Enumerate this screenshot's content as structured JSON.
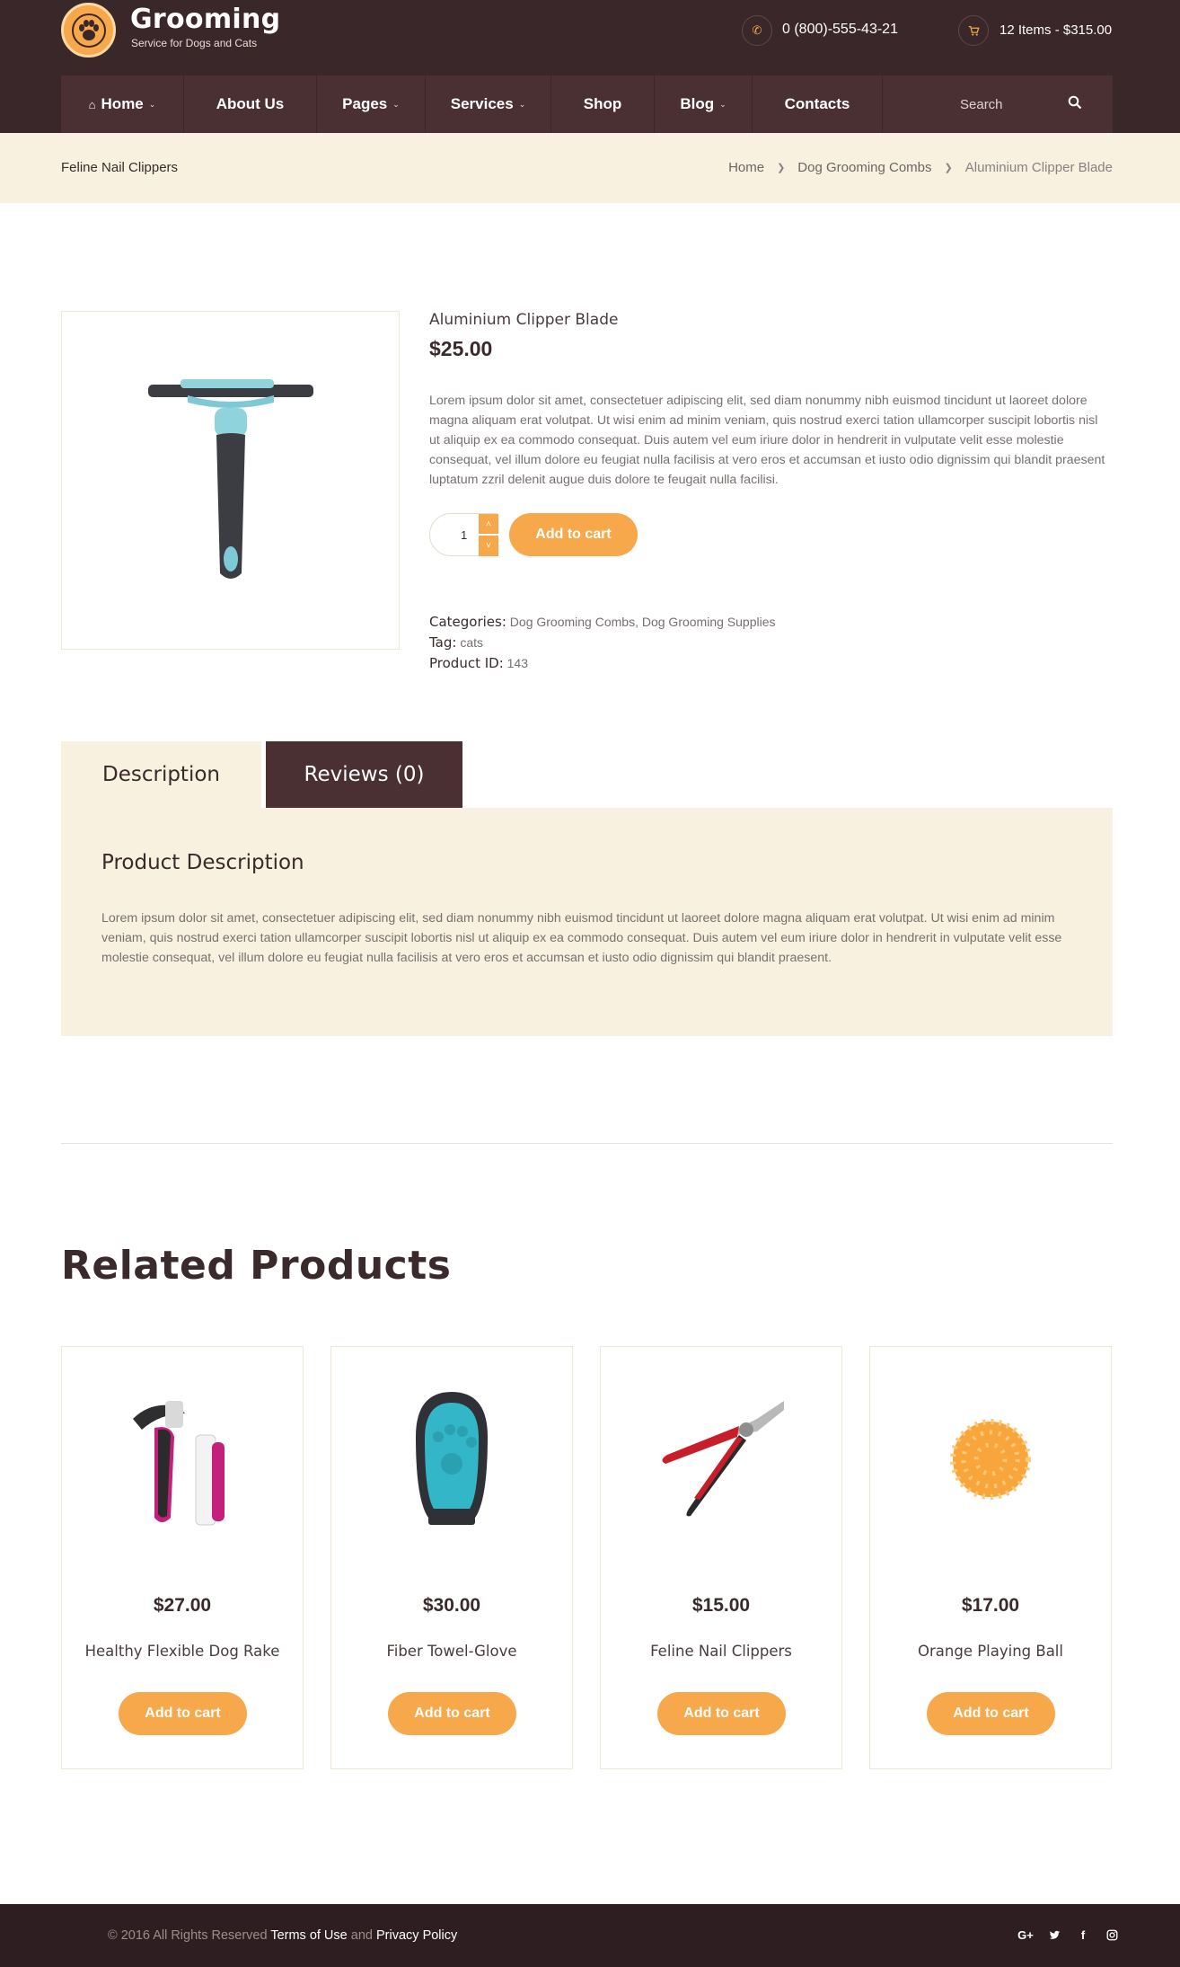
{
  "brand": {
    "title": "Grooming",
    "subtitle": "Service for Dogs and Cats",
    "accent": "#f6a84a",
    "dark": "#3a272a"
  },
  "header": {
    "phone": "0 (800)-555-43-21",
    "cart": "12 Items - $315.00"
  },
  "nav": {
    "items": [
      {
        "label": "Home",
        "has_dropdown": true,
        "icon": "home-icon"
      },
      {
        "label": "About Us",
        "has_dropdown": false
      },
      {
        "label": "Pages",
        "has_dropdown": true
      },
      {
        "label": "Services",
        "has_dropdown": true
      },
      {
        "label": "Shop",
        "has_dropdown": false
      },
      {
        "label": "Blog",
        "has_dropdown": true
      },
      {
        "label": "Contacts",
        "has_dropdown": false
      }
    ],
    "search_placeholder": "Search"
  },
  "breadcrumb": {
    "page_name": "Feline Nail Clippers",
    "items": [
      "Home",
      "Dog Grooming Combs",
      "Aluminium Clipper Blade"
    ]
  },
  "product": {
    "title": "Aluminium Clipper Blade",
    "price": "$25.00",
    "description": "Lorem ipsum dolor sit amet, consectetuer adipiscing elit, sed diam nonummy nibh euismod tincidunt ut laoreet dolore magna aliquam erat volutpat. Ut wisi enim ad minim veniam, quis nostrud exerci tation ullamcorper suscipit lobortis nisl ut aliquip ex ea commodo consequat. Duis autem vel eum iriure dolor in hendrerit in vulputate velit esse molestie consequat, vel illum dolore eu feugiat nulla facilisis at vero eros et accumsan et iusto odio dignissim qui blandit praesent luptatum zzril delenit augue duis dolore te feugait nulla facilisi.",
    "quantity": "1",
    "add_to_cart": "Add to cart",
    "categories_label": "Categories:",
    "categories": [
      "Dog Grooming Combs",
      "Dog Grooming Supplies"
    ],
    "category_sep": ",",
    "tag_label": "Tag:",
    "tag": "cats",
    "id_label": "Product ID:",
    "id": "143"
  },
  "tabs": {
    "description": "Description",
    "reviews": "Reviews (0)",
    "panel_title": "Product Description",
    "panel_text": "Lorem ipsum dolor sit amet, consectetuer adipiscing elit, sed diam nonummy nibh euismod tincidunt ut laoreet dolore magna aliquam erat volutpat. Ut wisi enim ad minim veniam, quis nostrud exerci tation ullamcorper suscipit lobortis nisl ut aliquip ex ea commodo consequat. Duis autem vel eum iriure dolor in hendrerit in vulputate velit esse molestie consequat, vel illum dolore eu feugiat nulla facilisis at vero eros et accumsan et iusto odio dignissim qui blandit praesent."
  },
  "related": {
    "title": "Related Products",
    "products": [
      {
        "price": "$27.00",
        "name": "Healthy Flexible Dog Rake",
        "button": "Add to cart"
      },
      {
        "price": "$30.00",
        "name": "Fiber Towel-Glove",
        "button": "Add to cart"
      },
      {
        "price": "$15.00",
        "name": "Feline Nail Clippers",
        "button": "Add to cart"
      },
      {
        "price": "$17.00",
        "name": "Orange Playing Ball",
        "button": "Add to cart"
      }
    ]
  },
  "footer": {
    "copyright": "© 2016 All Rights Reserved",
    "terms": "Terms of Use",
    "and": "and",
    "privacy": "Privacy Policy",
    "social": [
      "google-plus-icon",
      "twitter-icon",
      "facebook-icon",
      "instagram-icon"
    ]
  }
}
